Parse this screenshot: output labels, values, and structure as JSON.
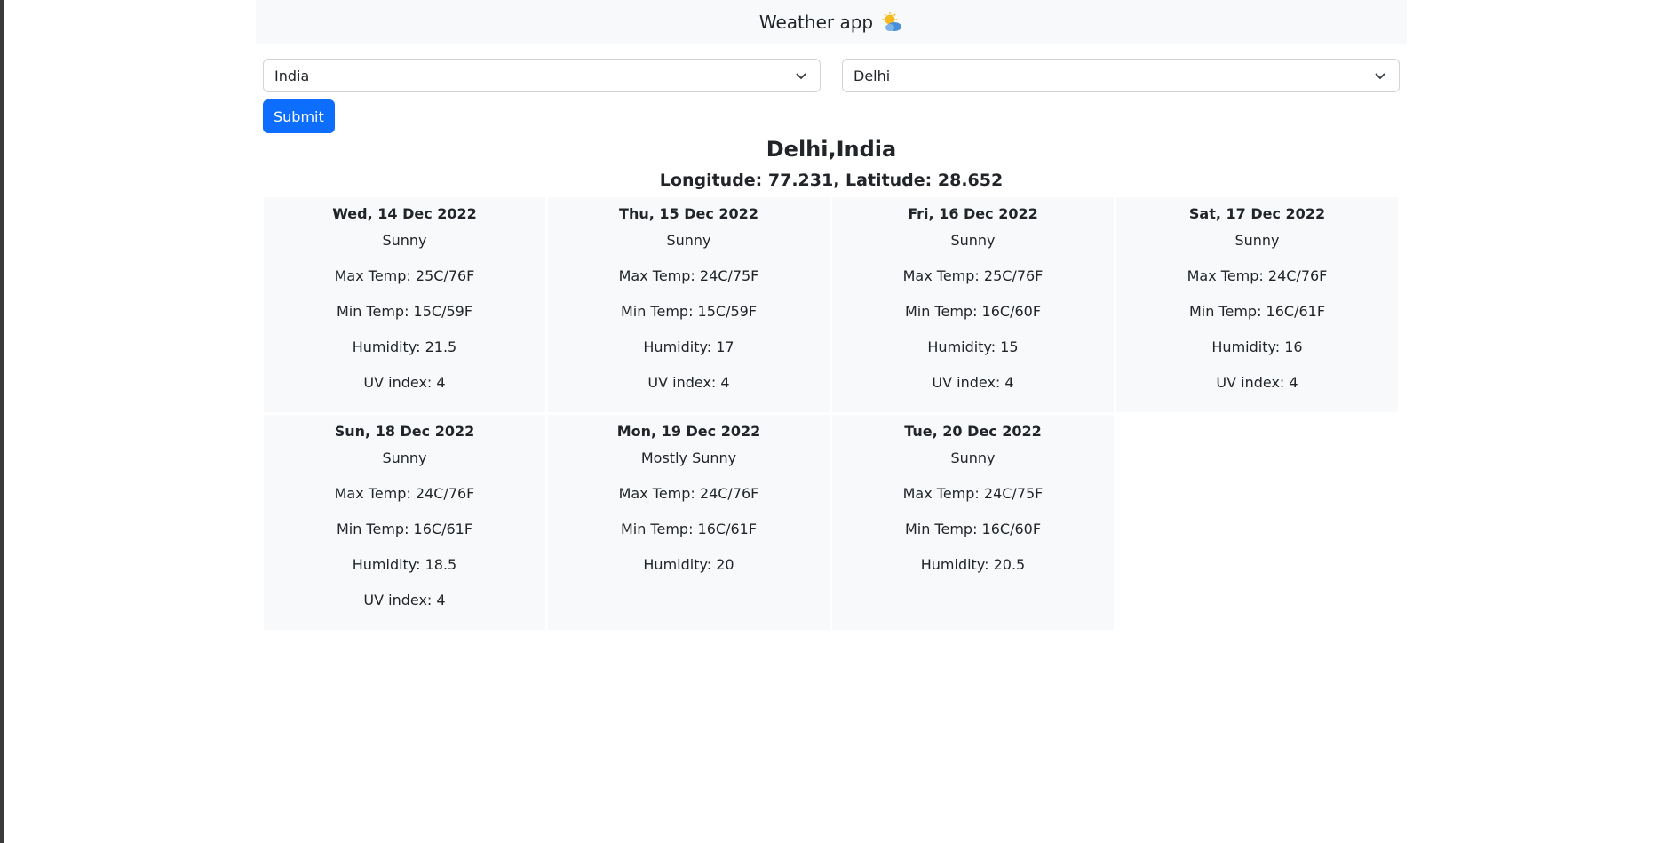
{
  "app": {
    "title": "Weather app",
    "icon": "sun-behind-cloud-icon"
  },
  "form": {
    "country": "India",
    "city": "Delhi",
    "submit_label": "Submit"
  },
  "location": {
    "title": "Delhi,India",
    "coords": "Longitude: 77.231, Latitude: 28.652"
  },
  "days": [
    {
      "date": "Wed, 14 Dec 2022",
      "condition": "Sunny",
      "max": "Max Temp: 25C/76F",
      "min": "Min Temp: 15C/59F",
      "humidity": "Humidity: 21.5",
      "uv": "UV index: 4"
    },
    {
      "date": "Thu, 15 Dec 2022",
      "condition": "Sunny",
      "max": "Max Temp: 24C/75F",
      "min": "Min Temp: 15C/59F",
      "humidity": "Humidity: 17",
      "uv": "UV index: 4"
    },
    {
      "date": "Fri, 16 Dec 2022",
      "condition": "Sunny",
      "max": "Max Temp: 25C/76F",
      "min": "Min Temp: 16C/60F",
      "humidity": "Humidity: 15",
      "uv": "UV index: 4"
    },
    {
      "date": "Sat, 17 Dec 2022",
      "condition": "Sunny",
      "max": "Max Temp: 24C/76F",
      "min": "Min Temp: 16C/61F",
      "humidity": "Humidity: 16",
      "uv": "UV index: 4"
    },
    {
      "date": "Sun, 18 Dec 2022",
      "condition": "Sunny",
      "max": "Max Temp: 24C/76F",
      "min": "Min Temp: 16C/61F",
      "humidity": "Humidity: 18.5",
      "uv": "UV index: 4"
    },
    {
      "date": "Mon, 19 Dec 2022",
      "condition": "Mostly Sunny",
      "max": "Max Temp: 24C/76F",
      "min": "Min Temp: 16C/61F",
      "humidity": "Humidity: 20",
      "uv": null
    },
    {
      "date": "Tue, 20 Dec 2022",
      "condition": "Sunny",
      "max": "Max Temp: 24C/75F",
      "min": "Min Temp: 16C/60F",
      "humidity": "Humidity: 20.5",
      "uv": null
    }
  ],
  "colors": {
    "primary": "#0d6efd",
    "card_bg": "#f8f9fa"
  }
}
